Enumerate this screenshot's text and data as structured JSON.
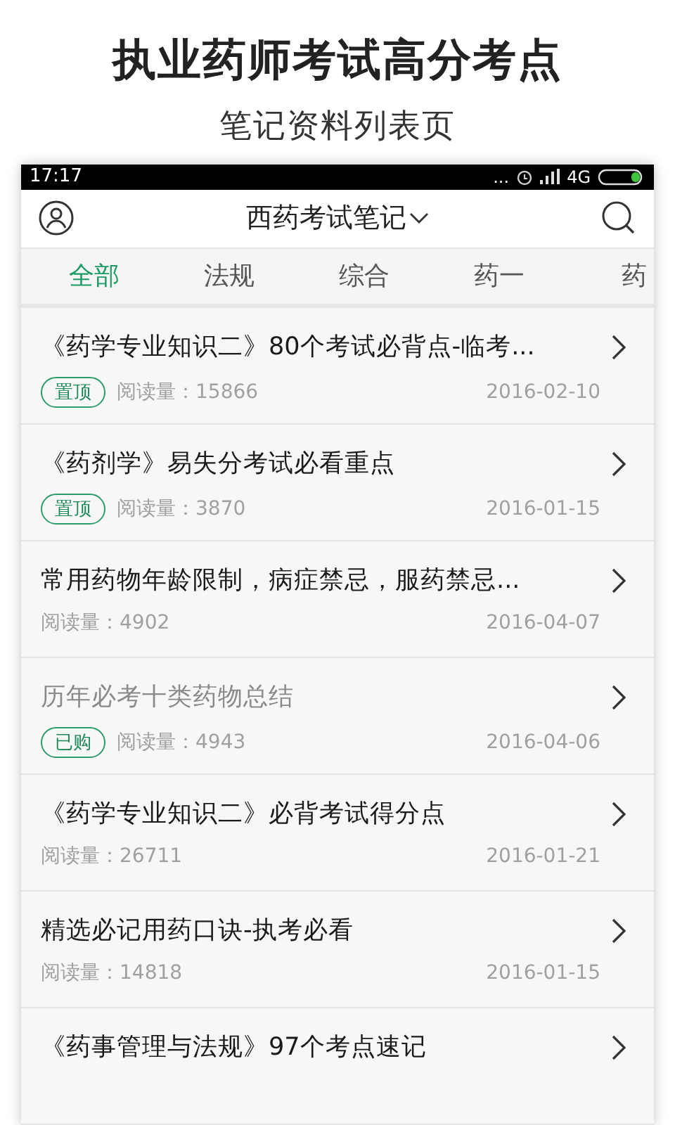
{
  "promo": {
    "title": "执业药师考试高分考点",
    "subtitle": "笔记资料列表页"
  },
  "status_bar": {
    "time": "17:17",
    "dots": "...",
    "network": "4G"
  },
  "header": {
    "title": "西药考试笔记"
  },
  "tabs": [
    {
      "label": "全部",
      "selected": true
    },
    {
      "label": "法规",
      "selected": false
    },
    {
      "label": "综合",
      "selected": false
    },
    {
      "label": "药一",
      "selected": false
    },
    {
      "label": "药",
      "selected": false
    }
  ],
  "notes": [
    {
      "title": "《药学专业知识二》80个考试必背点-临考...",
      "badge": "置顶",
      "reads": "阅读量：15866",
      "date": "2016-02-10",
      "read": false
    },
    {
      "title": "《药剂学》易失分考试必看重点",
      "badge": "置顶",
      "reads": "阅读量：3870",
      "date": "2016-01-15",
      "read": false
    },
    {
      "title": "常用药物年龄限制，病症禁忌，服药禁忌...",
      "reads": "阅读量：4902",
      "date": "2016-04-07",
      "read": false
    },
    {
      "title": "历年必考十类药物总结",
      "badge": "已购",
      "reads": "阅读量：4943",
      "date": "2016-04-06",
      "read": true
    },
    {
      "title": "《药学专业知识二》必背考试得分点",
      "reads": "阅读量：26711",
      "date": "2016-01-21",
      "read": false
    },
    {
      "title": "精选必记用药口诀-执考必看",
      "reads": "阅读量：14818",
      "date": "2016-01-15",
      "read": false
    },
    {
      "title": "《药事管理与法规》97个考点速记",
      "read": false
    }
  ]
}
